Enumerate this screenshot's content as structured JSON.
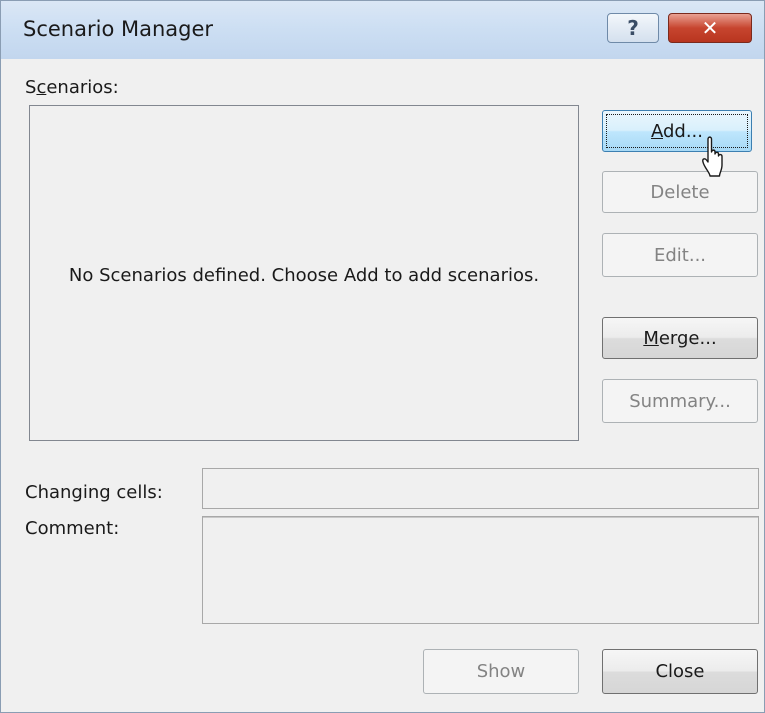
{
  "window": {
    "title": "Scenario Manager"
  },
  "titlebar": {
    "help_label": "?",
    "close_label": "✕"
  },
  "scenarios": {
    "label_pre": "S",
    "label_accel": "c",
    "label_post": "enarios:",
    "empty_message": "No Scenarios defined. Choose Add to add scenarios."
  },
  "buttons": {
    "add": {
      "accel": "A",
      "rest": "dd...",
      "enabled": true
    },
    "delete": {
      "label": "Delete",
      "enabled": false
    },
    "edit": {
      "label": "Edit...",
      "enabled": false
    },
    "merge": {
      "accel": "M",
      "rest": "erge...",
      "enabled": true
    },
    "summary": {
      "label": "Summary...",
      "enabled": false
    },
    "show": {
      "label": "Show",
      "enabled": false
    },
    "close": {
      "label": "Close",
      "enabled": true
    }
  },
  "fields": {
    "changing_cells": {
      "label": "Changing cells:",
      "value": ""
    },
    "comment": {
      "label": "Comment:",
      "value": ""
    }
  },
  "colors": {
    "titlebar": "#cddff3",
    "close_button": "#c7452f",
    "default_button": "#bee6fd",
    "dialog_bg": "#f0f0f0"
  },
  "icons": [
    "help-icon",
    "close-icon",
    "mouse-pointer-icon"
  ]
}
